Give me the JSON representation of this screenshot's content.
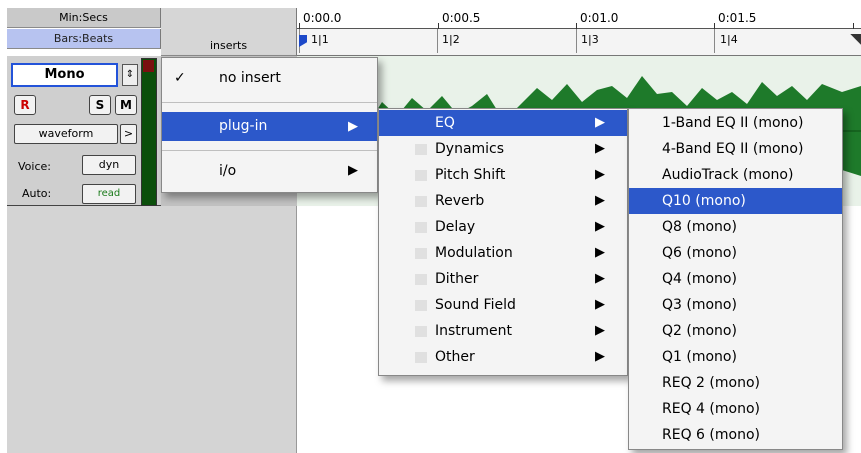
{
  "header": {
    "min_secs": "Min:Secs",
    "bars_beats": "Bars:Beats",
    "inserts": "inserts"
  },
  "ruler": {
    "time_ticks": [
      "0:00.0",
      "0:00.5",
      "0:01.0",
      "0:01.5"
    ],
    "bar_ticks": [
      "1|1",
      "1|2",
      "1|3",
      "1|4"
    ]
  },
  "track": {
    "mode": "Mono",
    "record": "R",
    "solo": "S",
    "mute": "M",
    "view": "waveform",
    "view_arrow": ">",
    "voice_label": "Voice:",
    "voice_value": "dyn",
    "auto_label": "Auto:",
    "auto_value": "read"
  },
  "menu_inserts": {
    "items": [
      {
        "label": "no insert",
        "checked": true
      },
      {
        "label": "plug-in",
        "submenu": true,
        "highlighted": true
      },
      {
        "label": "i/o",
        "submenu": true
      }
    ]
  },
  "menu_plugin": {
    "items": [
      {
        "label": "EQ",
        "highlighted": true
      },
      {
        "label": "Dynamics"
      },
      {
        "label": "Pitch Shift"
      },
      {
        "label": "Reverb"
      },
      {
        "label": "Delay"
      },
      {
        "label": "Modulation"
      },
      {
        "label": "Dither"
      },
      {
        "label": "Sound Field"
      },
      {
        "label": "Instrument"
      },
      {
        "label": "Other"
      }
    ]
  },
  "menu_eq": {
    "items": [
      {
        "label": "1-Band EQ II (mono)"
      },
      {
        "label": "4-Band EQ II (mono)"
      },
      {
        "label": "AudioTrack (mono)"
      },
      {
        "label": "Q10 (mono)",
        "highlighted": true
      },
      {
        "label": "Q8 (mono)"
      },
      {
        "label": "Q6 (mono)"
      },
      {
        "label": "Q4 (mono)"
      },
      {
        "label": "Q3 (mono)"
      },
      {
        "label": "Q2 (mono)"
      },
      {
        "label": "Q1 (mono)"
      },
      {
        "label": "REQ 2 (mono)"
      },
      {
        "label": "REQ 4 (mono)"
      },
      {
        "label": "REQ 6 (mono)"
      }
    ]
  },
  "icons": {
    "checkmark": "✓",
    "submenu_arrow": "▶",
    "stepper": "⇕",
    "end_marker": "◥"
  },
  "colors": {
    "highlight": "#2c58ca",
    "bars_header": "#b7c3f0",
    "waveform": "#1e7a2a",
    "record": "#cc0000"
  }
}
